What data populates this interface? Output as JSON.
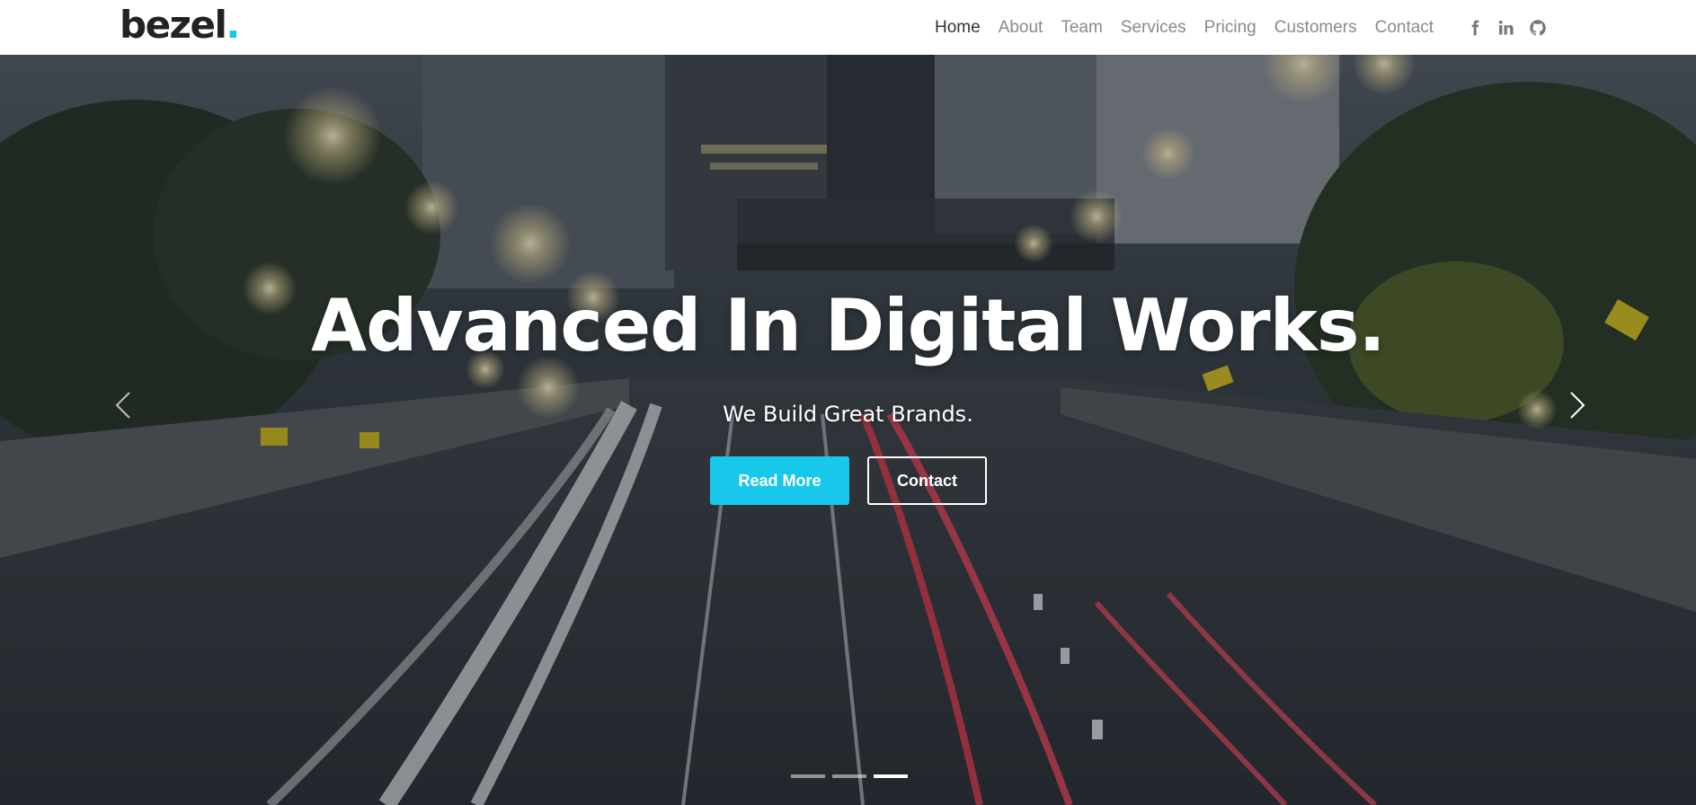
{
  "brand": {
    "name": "bezel",
    "dot": ".",
    "accent_color": "#18c8ea"
  },
  "nav": {
    "items": [
      {
        "label": "Home",
        "active": true
      },
      {
        "label": "About",
        "active": false
      },
      {
        "label": "Team",
        "active": false
      },
      {
        "label": "Services",
        "active": false
      },
      {
        "label": "Pricing",
        "active": false
      },
      {
        "label": "Customers",
        "active": false
      },
      {
        "label": "Contact",
        "active": false
      }
    ],
    "social": [
      "facebook-icon",
      "linkedin-icon",
      "github-icon"
    ]
  },
  "hero": {
    "title": "Advanced In Digital Works.",
    "subtitle": "We Build Great Brands.",
    "primary_button": "Read More",
    "secondary_button": "Contact",
    "slides": {
      "count": 3,
      "active_index": 2
    },
    "prev_icon": "chevron-left-icon",
    "next_icon": "chevron-right-icon"
  }
}
